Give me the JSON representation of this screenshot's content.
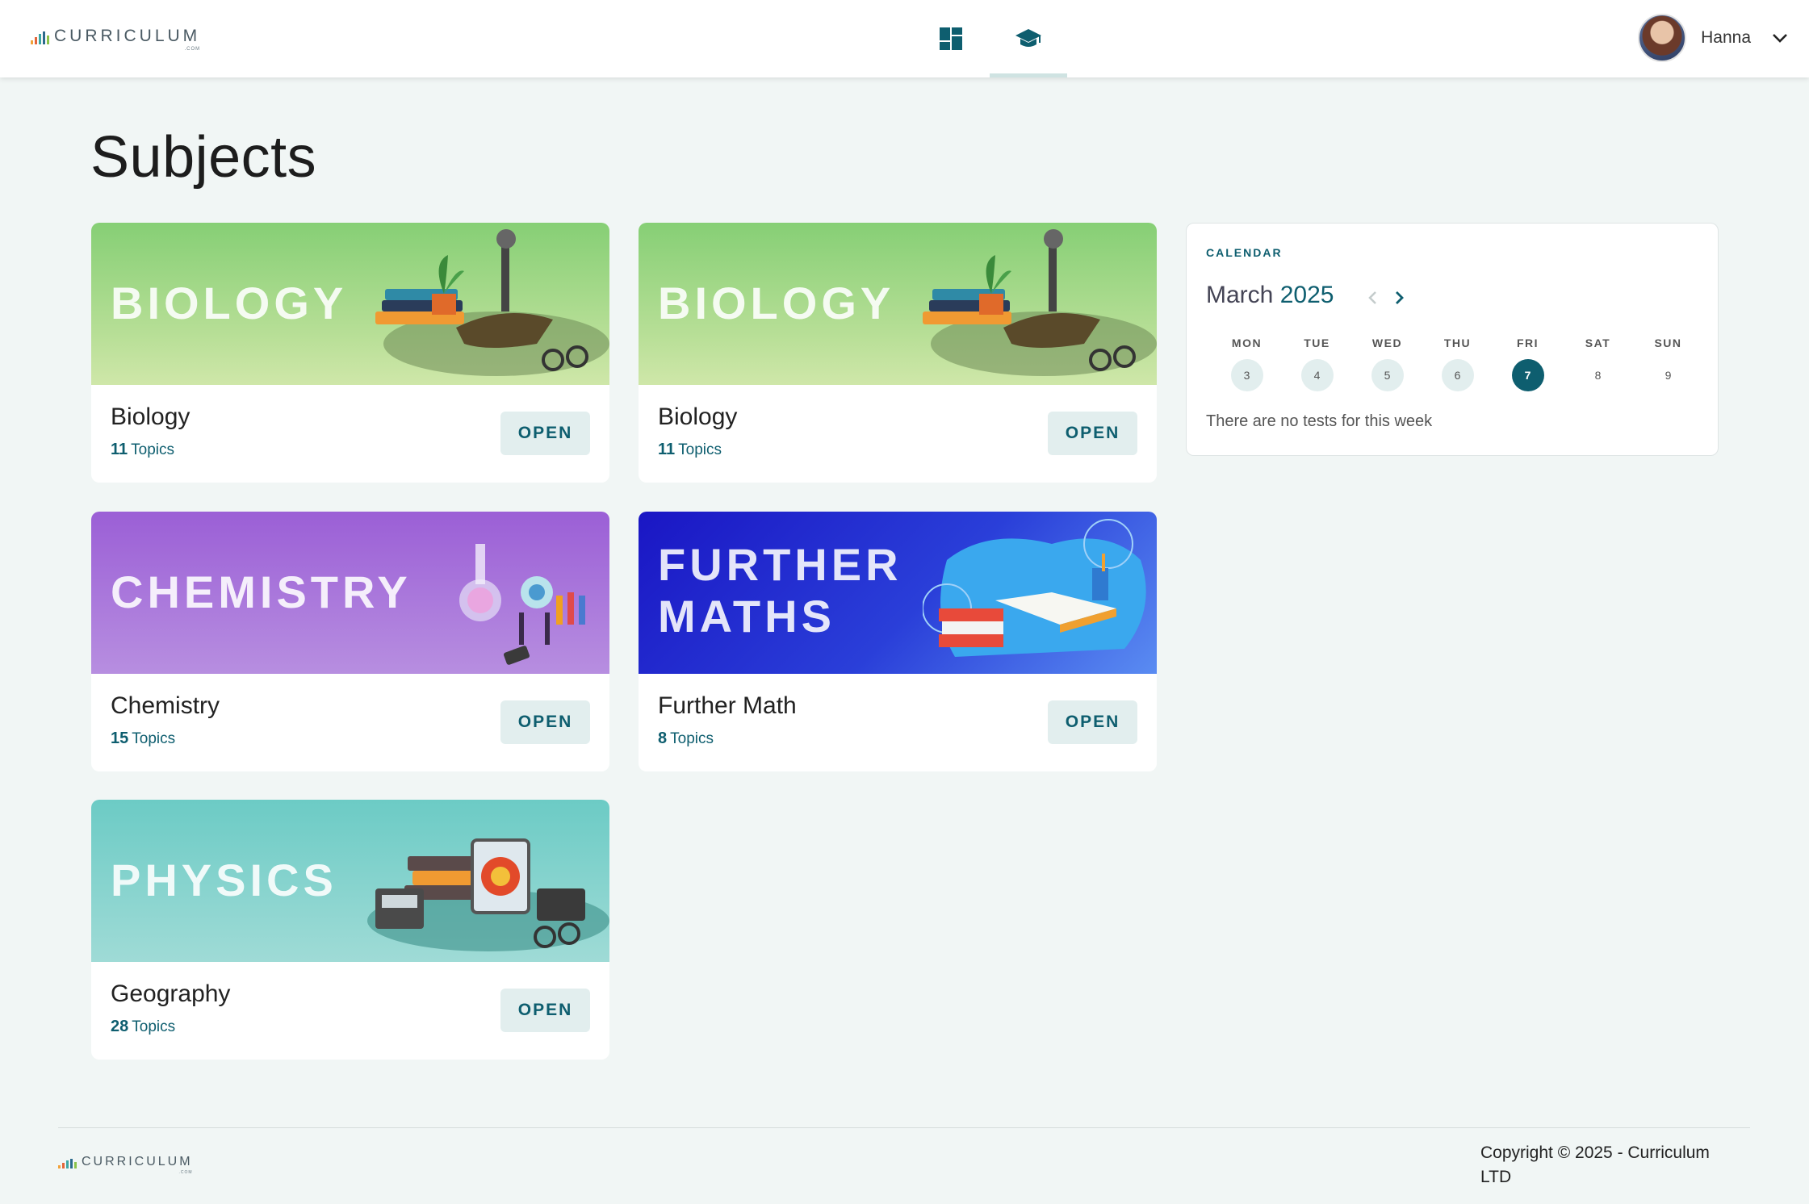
{
  "header": {
    "logo_text": "CURRICULUM",
    "logo_sub": ".COM",
    "nav": [
      {
        "name": "dashboard",
        "icon": "dashboard-icon",
        "active": false
      },
      {
        "name": "subjects",
        "icon": "graduation-cap-icon",
        "active": true
      }
    ],
    "user": {
      "name": "Hanna"
    }
  },
  "page": {
    "title": "Subjects"
  },
  "subjects": [
    {
      "banner": "BIOLOGY",
      "title": "Biology",
      "count": "11",
      "topics_label": "Topics",
      "action": "OPEN"
    },
    {
      "banner": "BIOLOGY",
      "title": "Biology",
      "count": "11",
      "topics_label": "Topics",
      "action": "OPEN"
    },
    {
      "banner": "CHEMISTRY",
      "title": "Chemistry",
      "count": "15",
      "topics_label": "Topics",
      "action": "OPEN"
    },
    {
      "banner_line1": "FURTHER",
      "banner_line2": "MATHS",
      "title": "Further Math",
      "count": "8",
      "topics_label": "Topics",
      "action": "OPEN"
    },
    {
      "banner": "PHYSICS",
      "title": "Geography",
      "count": "28",
      "topics_label": "Topics",
      "action": "OPEN"
    }
  ],
  "calendar": {
    "label": "CALENDAR",
    "month": "March",
    "year": "2025",
    "days": [
      {
        "name": "MON",
        "num": "3"
      },
      {
        "name": "TUE",
        "num": "4"
      },
      {
        "name": "WED",
        "num": "5"
      },
      {
        "name": "THU",
        "num": "6"
      },
      {
        "name": "FRI",
        "num": "7"
      },
      {
        "name": "SAT",
        "num": "8"
      },
      {
        "name": "SUN",
        "num": "9"
      }
    ],
    "empty_text": "There are no tests for this week"
  },
  "footer": {
    "logo_text": "CURRICULUM",
    "logo_sub": ".COM",
    "copyright": "Copyright © 2025 - Curriculum LTD"
  },
  "colors": {
    "accent": "#0e5e6f",
    "background": "#f1f6f5",
    "button_bg": "#e2eeee"
  }
}
